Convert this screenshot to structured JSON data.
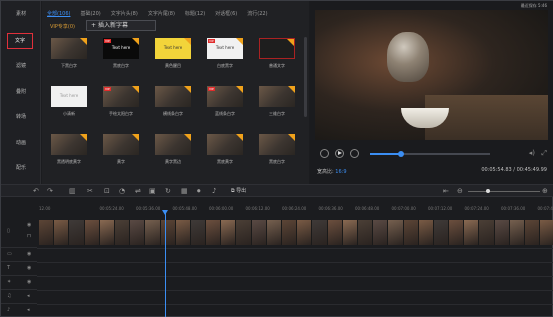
{
  "window": {
    "title": "最近保存 5:46"
  },
  "sidebar": {
    "items": [
      {
        "label": "素材"
      },
      {
        "label": "文字"
      },
      {
        "label": "滤镜"
      },
      {
        "label": "叠附"
      },
      {
        "label": "转场"
      },
      {
        "label": "动画"
      },
      {
        "label": "配乐"
      }
    ]
  },
  "library": {
    "tabs": [
      {
        "label": "全部(106)"
      },
      {
        "label": "基础(20)"
      },
      {
        "label": "文字片头(8)"
      },
      {
        "label": "文字片尾(8)"
      },
      {
        "label": "标题(12)"
      },
      {
        "label": "对话框(6)"
      },
      {
        "label": "流行(22)"
      }
    ],
    "vip_label": "VIP专享(0)",
    "add_button": "插入新字幕",
    "items": [
      {
        "label": "下黑白字"
      },
      {
        "label": "黑底白字",
        "thumb": "Text here"
      },
      {
        "label": "黄色醒目",
        "thumb": "Text here"
      },
      {
        "label": "白底黑字",
        "thumb": "Text here"
      },
      {
        "label": "普通文字"
      },
      {
        "label": "小清新",
        "thumb": "Text here"
      },
      {
        "label": "手绘太阳白字"
      },
      {
        "label": "横线条白字"
      },
      {
        "label": "蓝线条白字"
      },
      {
        "label": "三维白字"
      },
      {
        "label": "黑透明底黄字"
      },
      {
        "label": "黄字"
      },
      {
        "label": "黄字黑边"
      },
      {
        "label": "黑底黄字"
      },
      {
        "label": "黑底白字"
      }
    ]
  },
  "player": {
    "time": "00:05:54.83 / 00:45:49.99",
    "ratio_label": "宽高比:",
    "ratio_value": "16:9",
    "progress": 0.26
  },
  "toolbar": {
    "export_label": "导出"
  },
  "timeline": {
    "ruler": [
      "12.00",
      "00:05:24.00",
      "00:05:36.00",
      "00:05:48.00",
      "00:06:00.00",
      "00:06:12.00",
      "00:06:24.00",
      "00:06:36.00",
      "00:06:48.00",
      "00:07:00.00",
      "00:07:12.00",
      "00:07:24.00",
      "00:07:36.00",
      "00:07:48.00"
    ]
  },
  "colors": {
    "accent": "#3b8ef3",
    "active_border": "#e0303b",
    "vip": "#d79b35"
  }
}
